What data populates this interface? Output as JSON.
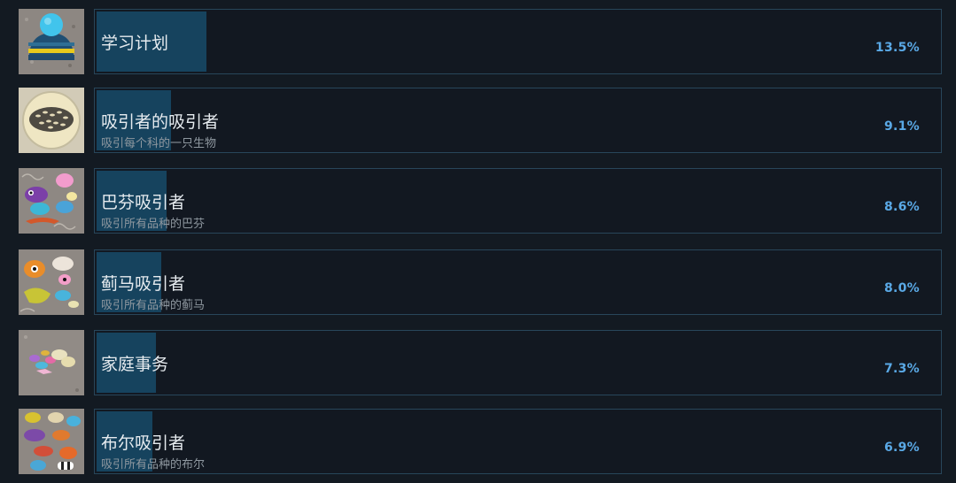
{
  "achievements": [
    {
      "title": "学习计划",
      "description": "",
      "percent": "13.5%",
      "fill": 0.135,
      "icon": "knit-hat-icon"
    },
    {
      "title": "吸引者的吸引者",
      "description": "吸引每个科的一只生物",
      "percent": "9.1%",
      "fill": 0.091,
      "icon": "fish-school-icon"
    },
    {
      "title": "巴芬吸引者",
      "description": "吸引所有品种的巴芬",
      "percent": "8.6%",
      "fill": 0.086,
      "icon": "puffin-critters-icon"
    },
    {
      "title": "蓟马吸引者",
      "description": "吸引所有品种的蓟马",
      "percent": "8.0%",
      "fill": 0.08,
      "icon": "thrips-critters-icon"
    },
    {
      "title": "家庭事务",
      "description": "",
      "percent": "7.3%",
      "fill": 0.073,
      "icon": "family-critters-icon"
    },
    {
      "title": "布尔吸引者",
      "description": "吸引所有品种的布尔",
      "percent": "6.9%",
      "fill": 0.069,
      "icon": "bull-fish-icon"
    }
  ],
  "colors": {
    "background": "#131a22",
    "bar_fill": "#16435e",
    "panel_border": "#28465a",
    "percent_text": "#5aa9e6"
  }
}
